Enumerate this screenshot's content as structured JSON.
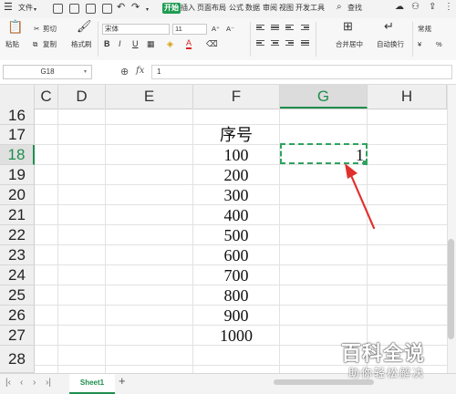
{
  "menubar": {
    "file_label": "文件",
    "tabs": [
      "开始",
      "插入",
      "页面布局",
      "公式",
      "数据",
      "审阅",
      "视图",
      "开发工具"
    ],
    "active_tab": "开始",
    "search_label": "查找"
  },
  "ribbon": {
    "paste_label": "粘贴",
    "cut_label": "剪切",
    "copy_label": "复制",
    "format_painter_label": "格式刷",
    "font_name": "宋体",
    "font_size": "11",
    "bold": "B",
    "italic": "I",
    "underline": "U",
    "font_color_glyph": "A",
    "grow_font": "A⁺",
    "shrink_font": "A⁻",
    "merge_label": "合并居中",
    "wrap_label": "自动换行",
    "number_format": "常规",
    "currency_glyph": "¥",
    "percent_glyph": "%"
  },
  "formula_bar": {
    "cell_ref": "G18",
    "fx_label": "fx",
    "value": "1"
  },
  "grid": {
    "columns": [
      "C",
      "D",
      "E",
      "F",
      "G",
      "H"
    ],
    "selected_column": "G",
    "rows": [
      "16",
      "17",
      "18",
      "19",
      "20",
      "21",
      "22",
      "23",
      "24",
      "25",
      "26",
      "27",
      "28"
    ],
    "selected_row": "18",
    "f_column_header": "序号",
    "f_values": [
      "100",
      "200",
      "300",
      "400",
      "500",
      "600",
      "700",
      "800",
      "900",
      "1000"
    ],
    "g18_value": "1"
  },
  "sheet_tabs": {
    "active": "Sheet1",
    "add_label": "+"
  },
  "watermark": {
    "main": "百科全说",
    "sub": "助你轻松解决"
  },
  "colors": {
    "accent": "#1e8e4e",
    "arrow": "#e0302c"
  }
}
